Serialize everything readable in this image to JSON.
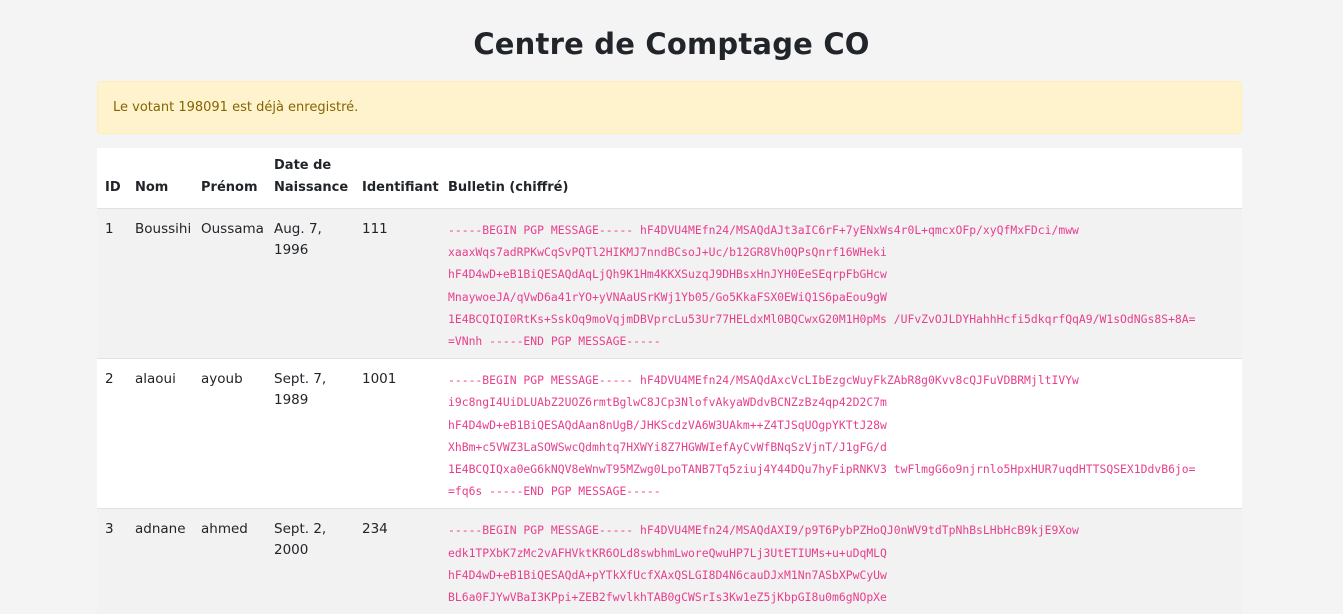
{
  "header": {
    "title": "Centre de Comptage CO"
  },
  "alert": {
    "message": "Le votant 198091 est déjà enregistré."
  },
  "table": {
    "headers": {
      "id": "ID",
      "nom": "Nom",
      "prenom": "Prénom",
      "date": "Date de Naissance",
      "identifiant": "Identifiant",
      "bulletin": "Bulletin (chiffré)"
    },
    "rows": [
      {
        "id": "1",
        "nom": "Boussihi",
        "prenom": "Oussama",
        "date": "Aug. 7, 1996",
        "identifiant": "111",
        "bulletin": [
          "-----BEGIN PGP MESSAGE----- hF4DVU4MEfn24/MSAQdAJt3aIC6rF+7yENxWs4r0L+qmcxOFp/xyQfMxFDci/mww",
          "xaaxWqs7adRPKwCqSvPQTl2HIKMJ7nndBCsoJ+Uc/b12GR8Vh0QPsQnrf16WHeki",
          "hF4D4wD+eB1BiQESAQdAqLjQh9K1Hm4KKXSuzqJ9DHBsxHnJYH0EeSEqrpFbGHcw",
          "MnaywoeJA/qVwD6a41rYO+yVNAaUSrKWj1Yb05/Go5KkaFSX0EWiQ1S6paEou9gW",
          "1E4BCQIQI0RtKs+SskOq9moVqjmDBVprcLu53Ur77HELdxMl0BQCwxG20M1H0pMs /UFvZvOJLDYHahhHcfi5dkqrfQqA9/W1sOdNGs8S+8A=",
          "=VNnh -----END PGP MESSAGE-----"
        ]
      },
      {
        "id": "2",
        "nom": "alaoui",
        "prenom": "ayoub",
        "date": "Sept. 7, 1989",
        "identifiant": "1001",
        "bulletin": [
          "-----BEGIN PGP MESSAGE----- hF4DVU4MEfn24/MSAQdAxcVcLIbEzgcWuyFkZAbR8g0Kvv8cQJFuVDBRMjltIVYw",
          "i9c8ngI4UiDLUAbZ2UOZ6rmtBglwC8JCp3NlofvAkyaWDdvBCNZzBz4qp42D2C7m",
          "hF4D4wD+eB1BiQESAQdAan8nUgB/JHKScdzVA6W3UAkm++Z4TJSqUOgpYKTtJ28w",
          "XhBm+c5VWZ3LaSOWSwcQdmhtq7HXWYi8Z7HGWWIefAyCvWfBNqSzVjnT/J1gFG/d",
          "1E4BCQIQxa0eG6kNQV8eWnwT95MZwg0LpoTANB7Tq5ziuj4Y44DQu7hyFipRNKV3 twFlmgG6o9njrnlo5HpxHUR7uqdHTTSQSEX1DdvB6jo=",
          "=fq6s -----END PGP MESSAGE-----"
        ]
      },
      {
        "id": "3",
        "nom": "adnane",
        "prenom": "ahmed",
        "date": "Sept. 2, 2000",
        "identifiant": "234",
        "bulletin": [
          "-----BEGIN PGP MESSAGE----- hF4DVU4MEfn24/MSAQdAXI9/p9T6PybPZHoQJ0nWV9tdTpNhBsLHbHcB9kjE9Xow",
          "edk1TPXbK7zMc2vAFHVktKR6OLd8swbhmLworeQwuHP7Lj3UtETIUMs+u+uDqMLQ",
          "hF4D4wD+eB1BiQESAQdA+pYTkXfUcfXAxQSLGI8D4N6cauDJxM1Nn7ASbXPwCyUw",
          "BL6a0FJYwVBaI3KPpi+ZEB2fwvlkhTAB0gCWSrIs3Kw1eZ5jKbpGI8u0m6gNOpXe"
        ]
      }
    ]
  }
}
